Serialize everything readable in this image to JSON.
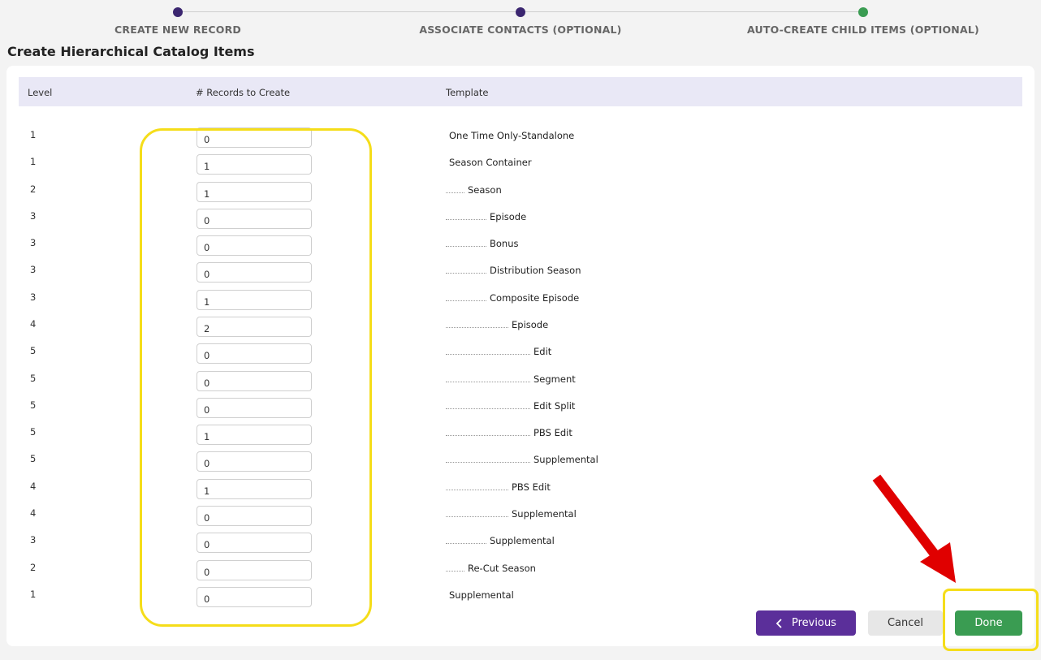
{
  "stepper": {
    "steps": [
      {
        "label": "CREATE NEW RECORD",
        "color": "#3b2670"
      },
      {
        "label": "ASSOCIATE CONTACTS (OPTIONAL)",
        "color": "#3b2670"
      },
      {
        "label": "AUTO-CREATE CHILD ITEMS (OPTIONAL)",
        "color": "#3a9c52"
      }
    ]
  },
  "page_title": "Create Hierarchical Catalog Items",
  "table": {
    "headers": {
      "level": "Level",
      "records": "# Records to Create",
      "template": "Template"
    },
    "rows": [
      {
        "level": "1",
        "value": "0",
        "template": "One Time Only-Standalone"
      },
      {
        "level": "1",
        "value": "1",
        "template": "Season Container"
      },
      {
        "level": "2",
        "value": "1",
        "template": "Season"
      },
      {
        "level": "3",
        "value": "0",
        "template": "Episode"
      },
      {
        "level": "3",
        "value": "0",
        "template": "Bonus"
      },
      {
        "level": "3",
        "value": "0",
        "template": "Distribution Season"
      },
      {
        "level": "3",
        "value": "1",
        "template": "Composite Episode"
      },
      {
        "level": "4",
        "value": "2",
        "template": "Episode"
      },
      {
        "level": "5",
        "value": "0",
        "template": "Edit"
      },
      {
        "level": "5",
        "value": "0",
        "template": "Segment"
      },
      {
        "level": "5",
        "value": "0",
        "template": "Edit Split"
      },
      {
        "level": "5",
        "value": "1",
        "template": "PBS Edit"
      },
      {
        "level": "5",
        "value": "0",
        "template": "Supplemental"
      },
      {
        "level": "4",
        "value": "1",
        "template": "PBS Edit"
      },
      {
        "level": "4",
        "value": "0",
        "template": "Supplemental"
      },
      {
        "level": "3",
        "value": "0",
        "template": "Supplemental"
      },
      {
        "level": "2",
        "value": "0",
        "template": "Re-Cut Season"
      },
      {
        "level": "1",
        "value": "0",
        "template": "Supplemental"
      }
    ]
  },
  "buttons": {
    "previous": "Previous",
    "cancel": "Cancel",
    "done": "Done"
  },
  "colors": {
    "accent_purple": "#5b2f9a",
    "done_green": "#3a9c52",
    "highlight_yellow": "#f5dd1a",
    "annotation_red": "#e00000"
  },
  "icons": {
    "previous": "chevron-left-icon"
  }
}
